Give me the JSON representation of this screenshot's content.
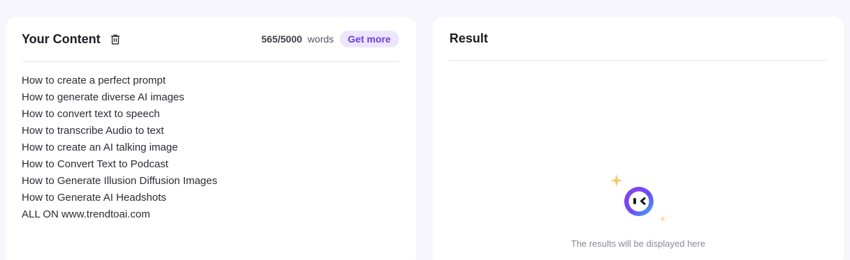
{
  "left_panel": {
    "title": "Your Content",
    "word_count_used": "565/5000",
    "word_count_unit": "words",
    "get_more_label": "Get more",
    "lines": [
      "How to create a perfect prompt",
      "How to generate diverse AI images",
      "How to convert text to speech",
      "How to transcribe Audio to text",
      "How to create an AI talking image",
      "How to Convert Text to Podcast",
      "How to Generate Illusion Diffusion Images",
      "How to Generate AI Headshots",
      "ALL ON www.trendtoai.com"
    ],
    "icons": {
      "delete": "trash-icon"
    }
  },
  "right_panel": {
    "title": "Result",
    "empty_message": "The results will be displayed here",
    "icons": {
      "mascot": "robot-face-icon",
      "sparkle": "sparkle-icon"
    }
  },
  "colors": {
    "accent": "#6a3fe0",
    "accent_bg": "#ece6fd",
    "sparkle": "#f7c96a",
    "page_bg": "#f7f6fc"
  }
}
